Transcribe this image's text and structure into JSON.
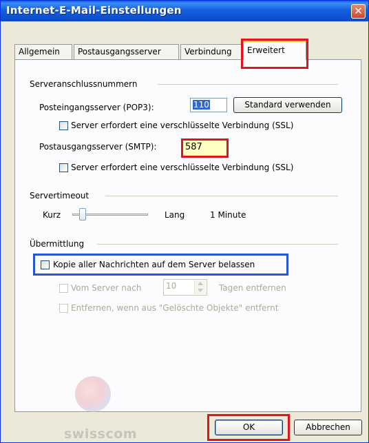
{
  "window": {
    "title": "Internet-E-Mail-Einstellungen",
    "close_glyph": "✕"
  },
  "tabs": [
    {
      "label": "Allgemein"
    },
    {
      "label": "Postausgangsserver"
    },
    {
      "label": "Verbindung"
    },
    {
      "label": "Erweitert",
      "active": true
    }
  ],
  "server_ports": {
    "group_label": "Serveranschlussnummern",
    "incoming_label": "Posteingangsserver (POP3):",
    "incoming_value": "110",
    "default_button": "Standard verwenden",
    "incoming_ssl_label": "Server erfordert eine verschlüsselte Verbindung (SSL)",
    "outgoing_label": "Postausgangsserver (SMTP):",
    "outgoing_value": "587",
    "outgoing_ssl_label": "Server erfordert eine verschlüsselte Verbindung (SSL)"
  },
  "timeout": {
    "group_label": "Servertimeout",
    "short_label": "Kurz",
    "long_label": "Lang",
    "value_label": "1 Minute",
    "level": 0.1
  },
  "delivery": {
    "group_label": "Übermittlung",
    "keep_copy_label": "Kopie aller Nachrichten auf dem Server belassen",
    "remove_after_prefix": "Vom Server nach",
    "remove_after_days": "10",
    "remove_after_suffix": "Tagen entfernen",
    "remove_deleted_label": "Entfernen, wenn aus \"Gelöschte Objekte\" entfernt"
  },
  "watermark": {
    "brand": "swisscom"
  },
  "buttons": {
    "ok": "OK",
    "cancel": "Abbrechen"
  },
  "colors": {
    "highlight_red": "#e0141c",
    "highlight_blue": "#2456d6",
    "smtp_field_bg": "#ffffc4"
  }
}
